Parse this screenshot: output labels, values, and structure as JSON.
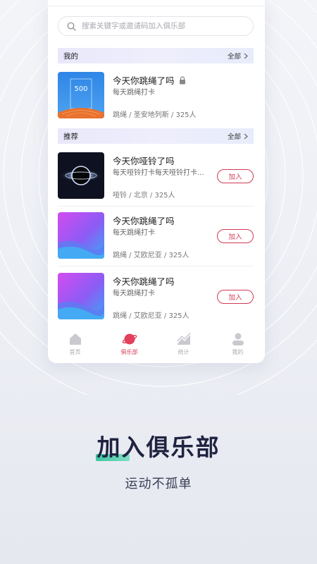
{
  "search": {
    "placeholder": "搜索关键字或邀请码加入俱乐部"
  },
  "sections": {
    "mine": {
      "title": "我的",
      "more": "全部"
    },
    "recommend": {
      "title": "推荐",
      "more": "全部"
    }
  },
  "my_clubs": [
    {
      "title": "今天你跳绳了吗",
      "desc": "每天跳绳打卡",
      "meta": "跳绳 / 圣安地列斯 / 325人",
      "thumb_text": "500",
      "locked": true
    }
  ],
  "recommended": [
    {
      "title": "今天你哑铃了吗",
      "desc": "每天哑铃打卡每天哑铃打卡...",
      "meta": "哑铃 / 北京 / 325人",
      "button": "加入"
    },
    {
      "title": "今天你跳绳了吗",
      "desc": "每天跳绳打卡",
      "meta": "跳绳 / 艾欧尼亚 / 325人",
      "button": "加入"
    },
    {
      "title": "今天你跳绳了吗",
      "desc": "每天跳绳打卡",
      "meta": "跳绳 / 艾欧尼亚 / 325人",
      "button": "加入"
    }
  ],
  "tabbar": [
    {
      "label": "首页",
      "icon": "home-icon",
      "active": false
    },
    {
      "label": "俱乐部",
      "icon": "planet-icon",
      "active": true
    },
    {
      "label": "统计",
      "icon": "chart-icon",
      "active": false
    },
    {
      "label": "我的",
      "icon": "user-icon",
      "active": false
    }
  ],
  "promo": {
    "headline": "加入俱乐部",
    "subline": "运动不孤单"
  },
  "colors": {
    "accent": "#d23a55",
    "highlight": "#3ec29e",
    "headline": "#1f2340"
  }
}
